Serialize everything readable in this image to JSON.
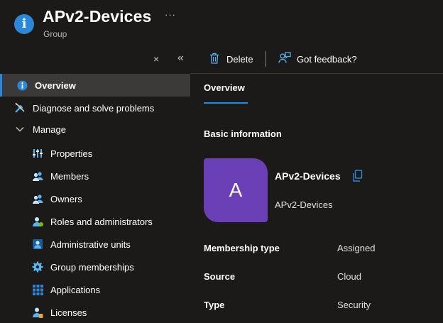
{
  "header": {
    "title": "APv2-Devices",
    "subtitle": "Group",
    "more": "···"
  },
  "nav": {
    "collapse_glyph": "«",
    "pin_glyph": "×",
    "items": [
      {
        "label": "Overview",
        "icon": "info-icon"
      },
      {
        "label": "Diagnose and solve problems",
        "icon": "tools-icon"
      },
      {
        "label": "Manage",
        "icon": "chevron-down-icon"
      },
      {
        "label": "Properties",
        "icon": "properties-icon"
      },
      {
        "label": "Members",
        "icon": "members-icon"
      },
      {
        "label": "Owners",
        "icon": "owners-icon"
      },
      {
        "label": "Roles and administrators",
        "icon": "roles-icon"
      },
      {
        "label": "Administrative units",
        "icon": "admin-units-icon"
      },
      {
        "label": "Group memberships",
        "icon": "gear-icon"
      },
      {
        "label": "Applications",
        "icon": "apps-grid-icon"
      },
      {
        "label": "Licenses",
        "icon": "licenses-icon"
      }
    ]
  },
  "toolbar": {
    "delete_label": "Delete",
    "feedback_label": "Got feedback?"
  },
  "tabs": {
    "overview": "Overview"
  },
  "basic": {
    "title": "Basic information",
    "avatar_letter": "A",
    "name": "APv2-Devices",
    "description": "APv2-Devices"
  },
  "properties": [
    {
      "label": "Membership type",
      "value": "Assigned"
    },
    {
      "label": "Source",
      "value": "Cloud"
    },
    {
      "label": "Type",
      "value": "Security"
    }
  ],
  "colors": {
    "accent": "#2b88d8",
    "avatar": "#6b3fb5",
    "background": "#1b1a19",
    "active_item": "#3b3a39"
  }
}
